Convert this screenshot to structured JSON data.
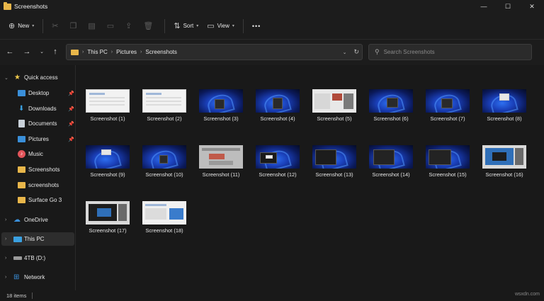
{
  "window": {
    "title": "Screenshots",
    "controls": {
      "minimize": "—",
      "maximize": "☐",
      "close": "✕"
    }
  },
  "toolbar": {
    "new_label": "New",
    "sort_label": "Sort",
    "view_label": "View",
    "more_label": "•••",
    "icons": [
      "cut-icon",
      "copy-icon",
      "paste-icon",
      "rename-icon",
      "share-icon",
      "delete-icon"
    ]
  },
  "address": {
    "breadcrumbs": [
      "This PC",
      "Pictures",
      "Screenshots"
    ],
    "search_placeholder": "Search Screenshots"
  },
  "sidebar": {
    "items": [
      {
        "label": "Quick access",
        "icon": "star-icon",
        "color": "#f2c94c"
      },
      {
        "label": "Desktop",
        "icon": "desktop-icon",
        "color": "#3a8fd9"
      },
      {
        "label": "Downloads",
        "icon": "download-icon",
        "color": "#3aa0e0"
      },
      {
        "label": "Documents",
        "icon": "documents-icon",
        "color": "#c9d1d9"
      },
      {
        "label": "Pictures",
        "icon": "pictures-icon",
        "color": "#3a8fd9"
      },
      {
        "label": "Music",
        "icon": "music-icon",
        "color": "#e2545a"
      },
      {
        "label": "Screenshots",
        "icon": "folder-icon",
        "color": "#e8b64a"
      },
      {
        "label": "screenshots",
        "icon": "folder-icon",
        "color": "#e8b64a"
      },
      {
        "label": "Surface Go 3",
        "icon": "folder-icon",
        "color": "#e8b64a"
      },
      {
        "label": "OneDrive",
        "icon": "cloud-icon",
        "color": "#3a8fd9"
      },
      {
        "label": "This PC",
        "icon": "computer-icon",
        "color": "#3aa0e0"
      },
      {
        "label": "4TB (D:)",
        "icon": "drive-icon",
        "color": "#9a9a9a"
      },
      {
        "label": "Network",
        "icon": "network-icon",
        "color": "#3a8fd9"
      }
    ]
  },
  "files": [
    {
      "name": "Screenshot (1)"
    },
    {
      "name": "Screenshot (2)"
    },
    {
      "name": "Screenshot (3)"
    },
    {
      "name": "Screenshot (4)"
    },
    {
      "name": "Screenshot (5)"
    },
    {
      "name": "Screenshot (6)"
    },
    {
      "name": "Screenshot (7)"
    },
    {
      "name": "Screenshot (8)"
    },
    {
      "name": "Screenshot (9)"
    },
    {
      "name": "Screenshot (10)"
    },
    {
      "name": "Screenshot (11)"
    },
    {
      "name": "Screenshot (12)"
    },
    {
      "name": "Screenshot (13)"
    },
    {
      "name": "Screenshot (14)"
    },
    {
      "name": "Screenshot (15)"
    },
    {
      "name": "Screenshot (16)"
    },
    {
      "name": "Screenshot (17)"
    },
    {
      "name": "Screenshot (18)"
    }
  ],
  "status": {
    "item_count": "18 items"
  },
  "watermark": "wsxdn.com"
}
